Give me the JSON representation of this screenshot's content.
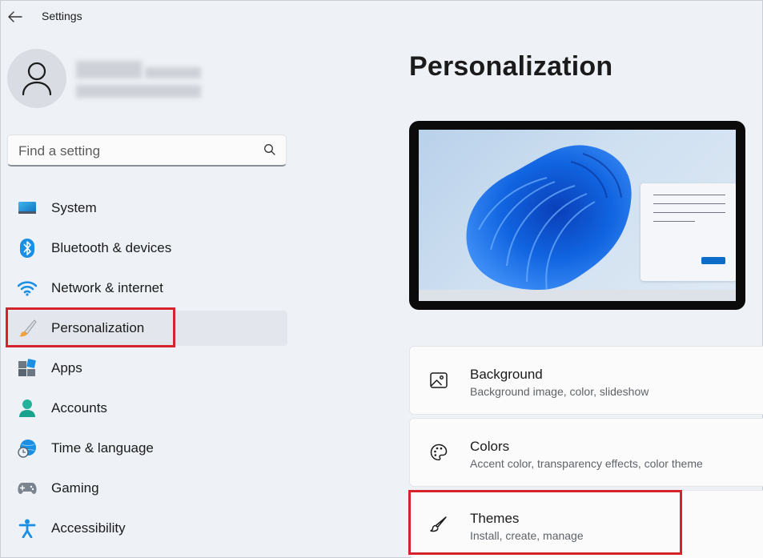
{
  "window": {
    "title": "Settings"
  },
  "search": {
    "placeholder": "Find a setting"
  },
  "sidebar": {
    "items": [
      {
        "label": "System",
        "icon": "monitor-icon"
      },
      {
        "label": "Bluetooth & devices",
        "icon": "bluetooth-icon"
      },
      {
        "label": "Network & internet",
        "icon": "wifi-icon"
      },
      {
        "label": "Personalization",
        "icon": "paintbrush-icon",
        "selected": true
      },
      {
        "label": "Apps",
        "icon": "apps-icon"
      },
      {
        "label": "Accounts",
        "icon": "person-icon"
      },
      {
        "label": "Time & language",
        "icon": "globe-clock-icon"
      },
      {
        "label": "Gaming",
        "icon": "gamepad-icon"
      },
      {
        "label": "Accessibility",
        "icon": "accessibility-icon"
      }
    ]
  },
  "main": {
    "title": "Personalization",
    "cards": [
      {
        "title": "Background",
        "subtitle": "Background image, color, slideshow",
        "icon": "image-icon"
      },
      {
        "title": "Colors",
        "subtitle": "Accent color, transparency effects, color theme",
        "icon": "palette-icon"
      },
      {
        "title": "Themes",
        "subtitle": "Install, create, manage",
        "icon": "brush-icon"
      }
    ]
  },
  "colors": {
    "accent": "#0b6cc9",
    "highlight": "#d6232b",
    "background": "#eef2f7"
  }
}
